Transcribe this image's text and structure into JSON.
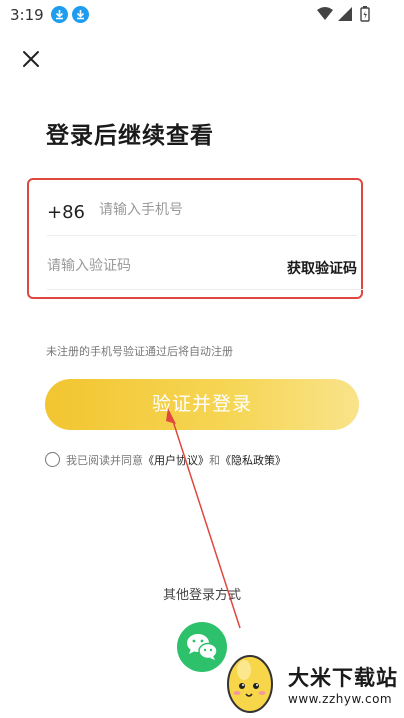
{
  "status_bar": {
    "time": "3:19"
  },
  "title": "登录后继续查看",
  "form": {
    "country_code": "+86",
    "phone_placeholder": "请输入手机号",
    "code_placeholder": "请输入验证码",
    "get_code_label": "获取验证码"
  },
  "hint": "未注册的手机号验证通过后将自动注册",
  "login_button": "验证并登录",
  "agreement": {
    "prefix": "我已阅读并同意",
    "user_agreement": "《用户协议》",
    "and": "和",
    "privacy_policy": "《隐私政策》"
  },
  "other_login": {
    "title": "其他登录方式",
    "methods": [
      "wechat-icon"
    ]
  },
  "watermark": {
    "name": "大米下载站",
    "url": "www.zzhyw.com"
  },
  "colors": {
    "accent": "#f2c530",
    "highlight_border": "#e0473f",
    "wechat": "#2dc16b"
  }
}
